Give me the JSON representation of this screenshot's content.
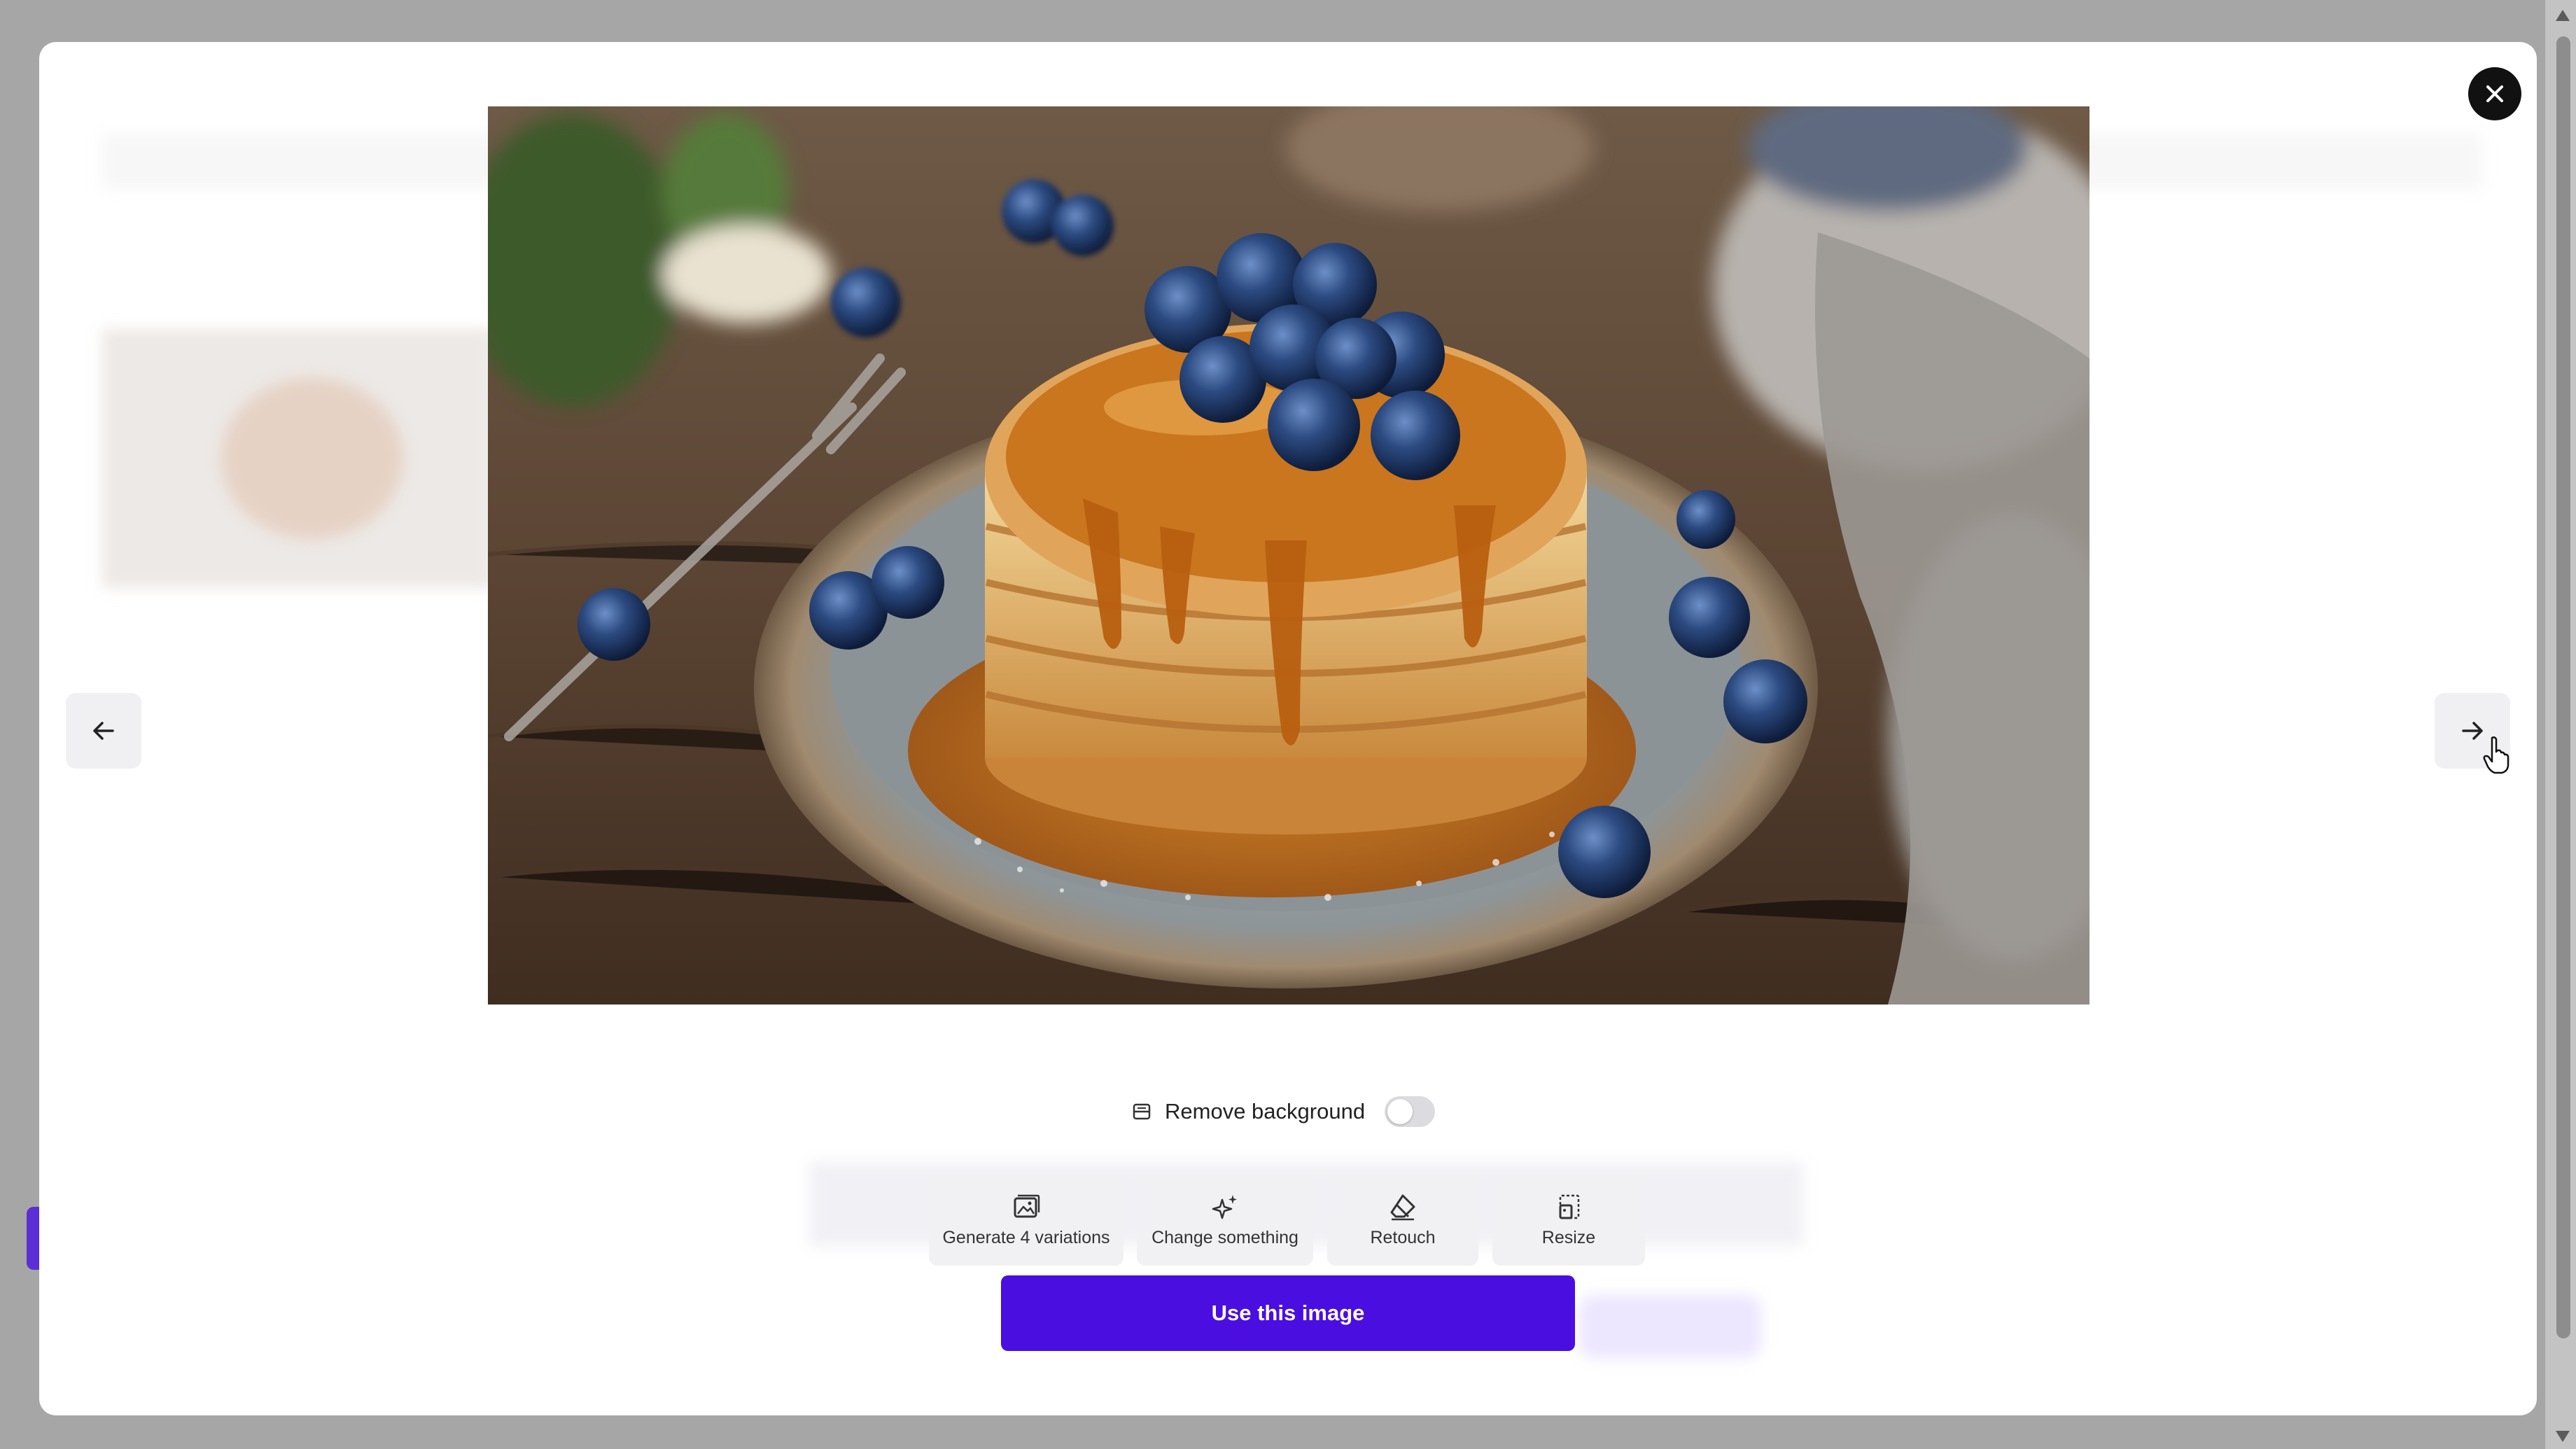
{
  "modal": {
    "close_label": "close",
    "remove_background": {
      "label": "Remove background",
      "enabled": false
    },
    "tools": [
      {
        "label": "Generate 4 variations",
        "icon": "image-variations-icon"
      },
      {
        "label": "Change something",
        "icon": "sparkle-icon"
      },
      {
        "label": "Retouch",
        "icon": "eraser-icon"
      },
      {
        "label": "Resize",
        "icon": "resize-icon"
      }
    ],
    "primary_action": "Use this image"
  },
  "colors": {
    "primary": "#4a0ee0",
    "close_button": "#111111",
    "accent": "#5a2fd6"
  }
}
